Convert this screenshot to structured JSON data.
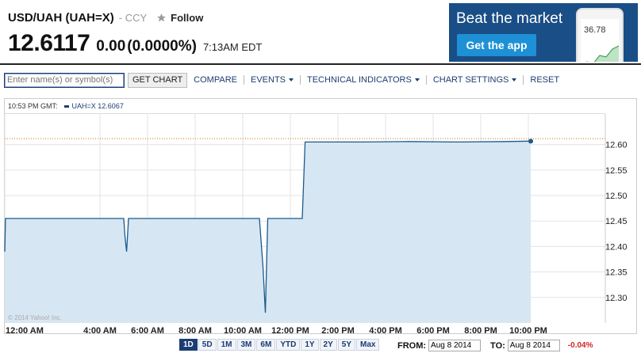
{
  "quote": {
    "symbol_title": "USD/UAH (UAH=X)",
    "exchange": "- CCY",
    "follow_label": "Follow",
    "price": "12.6117",
    "change": "0.00",
    "change_pct": "(0.0000%)",
    "time": "7:13AM EDT"
  },
  "ad": {
    "title": "Beat the market",
    "button_label": "Get the app",
    "phone_value": "36.78"
  },
  "toolbar": {
    "symbol_placeholder": "Enter name(s) or symbol(s)",
    "get_chart_label": "GET CHART",
    "compare_label": "COMPARE",
    "events_label": "EVENTS",
    "technical_label": "TECHNICAL INDICATORS",
    "settings_label": "CHART SETTINGS",
    "reset_label": "RESET"
  },
  "legend": {
    "time": "10:53 PM GMT:",
    "series_label": "UAH=X 12.6067"
  },
  "watermark": "© 2014 Yahoo! Inc.",
  "colors": {
    "accent": "#1c3c72",
    "line": "#1c5a8c",
    "fill": "#d6e6f3",
    "negative": "#d42323",
    "ad_bg": "#1a4e86"
  },
  "ranges": [
    "1D",
    "5D",
    "1M",
    "3M",
    "6M",
    "YTD",
    "1Y",
    "2Y",
    "5Y",
    "Max"
  ],
  "active_range": "1D",
  "dates": {
    "from_label": "FROM:",
    "from_value": "Aug 8 2014",
    "to_label": "TO:",
    "to_value": "Aug 8 2014",
    "range_change": "-0.04%"
  },
  "chart_data": {
    "type": "area",
    "x_unit": "hours",
    "x_range": [
      0,
      24
    ],
    "x_tick_labels": [
      "12:00 AM",
      "4:00 AM",
      "6:00 AM",
      "8:00 AM",
      "10:00 AM",
      "12:00 PM",
      "2:00 PM",
      "4:00 PM",
      "6:00 PM",
      "8:00 PM",
      "10:00 PM"
    ],
    "x_tick_hours": [
      0,
      4,
      6,
      8,
      10,
      12,
      14,
      16,
      18,
      20,
      22
    ],
    "ylim": [
      12.25,
      12.66
    ],
    "y_ticks": [
      12.3,
      12.35,
      12.4,
      12.45,
      12.5,
      12.55,
      12.6
    ],
    "y_tick_labels": [
      "12.30",
      "12.35",
      "12.40",
      "12.45",
      "12.50",
      "12.55",
      "12.60"
    ],
    "reference_line": 12.6117,
    "series": [
      {
        "x": [
          0,
          0.03,
          5,
          5.05,
          5.12,
          5.2,
          10.7,
          10.85,
          10.95,
          11.05,
          12.5,
          12.62,
          15,
          17,
          19,
          21,
          22.1
        ],
        "y": [
          12.39,
          12.455,
          12.455,
          12.42,
          12.39,
          12.455,
          12.455,
          12.36,
          12.27,
          12.455,
          12.455,
          12.605,
          12.605,
          12.606,
          12.605,
          12.606,
          12.6067
        ]
      }
    ]
  }
}
